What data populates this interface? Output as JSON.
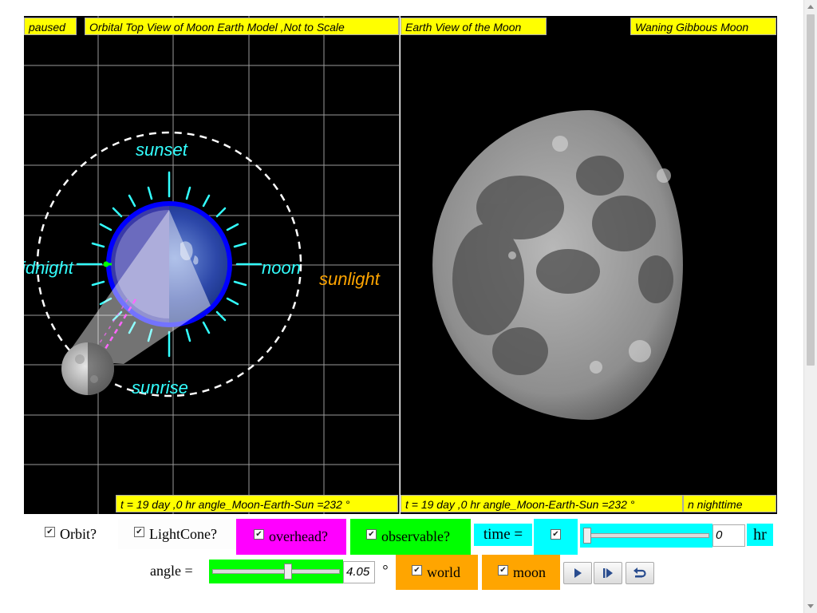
{
  "left_panel": {
    "status": "paused",
    "title": "Orbital Top View of Moon Earth Model ,Not to Scale",
    "labels": {
      "sunset": "sunset",
      "midnight": "idnight",
      "noon": "noon",
      "sunlight": "sunlight",
      "sunrise": "sunrise"
    },
    "footer": "t = 19 day ,0 hr angle_Moon-Earth-Sun =232 °"
  },
  "right_panel": {
    "title": "Earth View of the Moon",
    "phase": "Waning Gibbous Moon",
    "footer": "t = 19 day ,0 hr angle_Moon-Earth-Sun =232 °",
    "footer_right": "n nighttime"
  },
  "controls": {
    "orbit": {
      "label": "Orbit?",
      "checked": true
    },
    "lightcone": {
      "label": "LightCone?",
      "checked": true
    },
    "overhead": {
      "label": "overhead?",
      "checked": true
    },
    "observable": {
      "label": "observable?",
      "checked": true
    },
    "time_label": "time =",
    "time_check": {
      "checked": true
    },
    "time_value": "0",
    "time_unit": "hr",
    "time_slider_fraction": 0,
    "angle_label": "angle =",
    "angle_value": "4.05",
    "angle_unit": "°",
    "angle_slider_fraction": 0.6,
    "world": {
      "label": "world",
      "checked": true
    },
    "moon": {
      "label": "moon",
      "checked": true
    },
    "buttons": [
      "play-icon",
      "step-icon",
      "reset-icon"
    ]
  },
  "colors": {
    "label_bg": "#ffff00",
    "cyan": "#33ffff",
    "orange": "#ffa500",
    "magenta": "#ff00ff",
    "green": "#00ff00",
    "aqua": "#00ffff",
    "earth": "#0000ff"
  }
}
